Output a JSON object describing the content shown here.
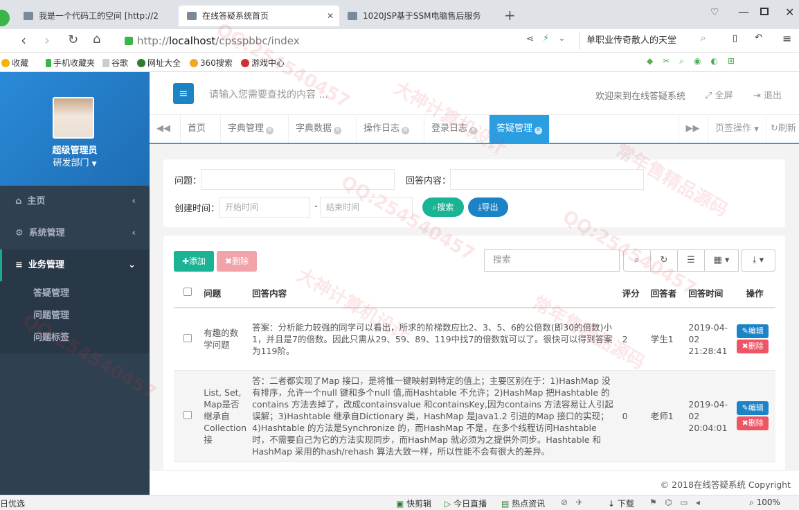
{
  "browser": {
    "tabs": [
      {
        "label": "我是一个代码工的空间 [http://2"
      },
      {
        "label": "在线答疑系统首页"
      },
      {
        "label": "1020JSP基于SSM电脑售后服务"
      }
    ],
    "url_prefix": "http://",
    "url_host": "localhost",
    "url_path": "/cpsspbbc/index",
    "search_text": "单职业传奇散人的天堂",
    "bookmarks": [
      "收藏",
      "手机收藏夹",
      "谷歌",
      "网址大全",
      "360搜索",
      "游戏中心"
    ]
  },
  "sidebar": {
    "user_name": "超级管理员",
    "department": "研发部门",
    "nav": [
      {
        "label": "主页",
        "icon": "home-icon"
      },
      {
        "label": "系统管理",
        "icon": "gear-icon"
      },
      {
        "label": "业务管理",
        "icon": "bars-icon"
      }
    ],
    "sub_items": [
      "答疑管理",
      "问题管理",
      "问题标签"
    ]
  },
  "header": {
    "search_placeholder": "请输入您需要查找的内容 ...",
    "welcome": "欢迎来到在线答疑系统",
    "fullscreen": "全屏",
    "logout": "退出"
  },
  "page_tabs": {
    "items": [
      "首页",
      "字典管理",
      "字典数据",
      "操作日志",
      "登录日志",
      "答疑管理"
    ],
    "tab_ops": "页签操作",
    "refresh": "刷新"
  },
  "search_form": {
    "question_label": "问题：",
    "answer_label": "回答内容：",
    "created_label": "创建时间：",
    "start_placeholder": "开始时间",
    "end_placeholder": "结束时间",
    "dash": "-",
    "search_btn": "搜索",
    "export_btn": "导出"
  },
  "toolbar": {
    "add": "添加",
    "delete": "删除",
    "search_placeholder": "搜索"
  },
  "table": {
    "headers": [
      "问题",
      "回答内容",
      "评分",
      "回答者",
      "回答时间",
      "操作"
    ],
    "edit_label": "编辑",
    "delete_label": "删除",
    "rows": [
      {
        "question": "有趣的数学问题",
        "answer": "答案：分析能力较强的同学可以看出，所求的阶梯数应比2、3、5、6的公倍数(即30的倍数)小1，并且是7的倍数。因此只需从29、59、89、119中找7的倍数就可以了。很快可以得到答案为119阶。",
        "score": "2",
        "answerer": "学生1",
        "time": "2019-04-02 21:28:41"
      },
      {
        "question": "List, Set, Map是否继承自Collection接",
        "answer": "答：二者都实现了Map 接口，是将惟一键映射到特定的值上；主要区别在于：1)HashMap 没有排序，允许一个null 键和多个null 值,而Hashtable 不允许；2)HashMap 把Hashtable 的contains 方法去掉了，改成containsvalue 和containsKey,因为contains 方法容易让人引起误解；3)Hashtable 继承自Dictionary 类，HashMap 是Java1.2 引进的Map 接口的实现；4)Hashtable 的方法是Synchronize 的，而HashMap 不是，在多个线程访问Hashtable 时，不需要自己为它的方法实现同步，而HashMap 就必须为之提供外同步。Hashtable 和HashMap 采用的hash/rehash 算法大致一样，所以性能不会有很大的差异。",
        "score": "0",
        "answerer": "老师1",
        "time": "2019-04-02 20:04:01"
      }
    ]
  },
  "footer": {
    "copyright": "© 2018在线答疑系统 Copyright"
  },
  "statusbar": {
    "left": "日优选",
    "items": [
      "快剪辑",
      "今日直播",
      "热点资讯",
      "下载",
      "100%"
    ]
  },
  "watermarks": [
    "QQ:254540457",
    "大神计算机设计",
    "常年售精品源码"
  ],
  "colors": {
    "sidebar": "#2f4050",
    "accent": "#2a9ee0",
    "primary_green": "#1ab394"
  }
}
